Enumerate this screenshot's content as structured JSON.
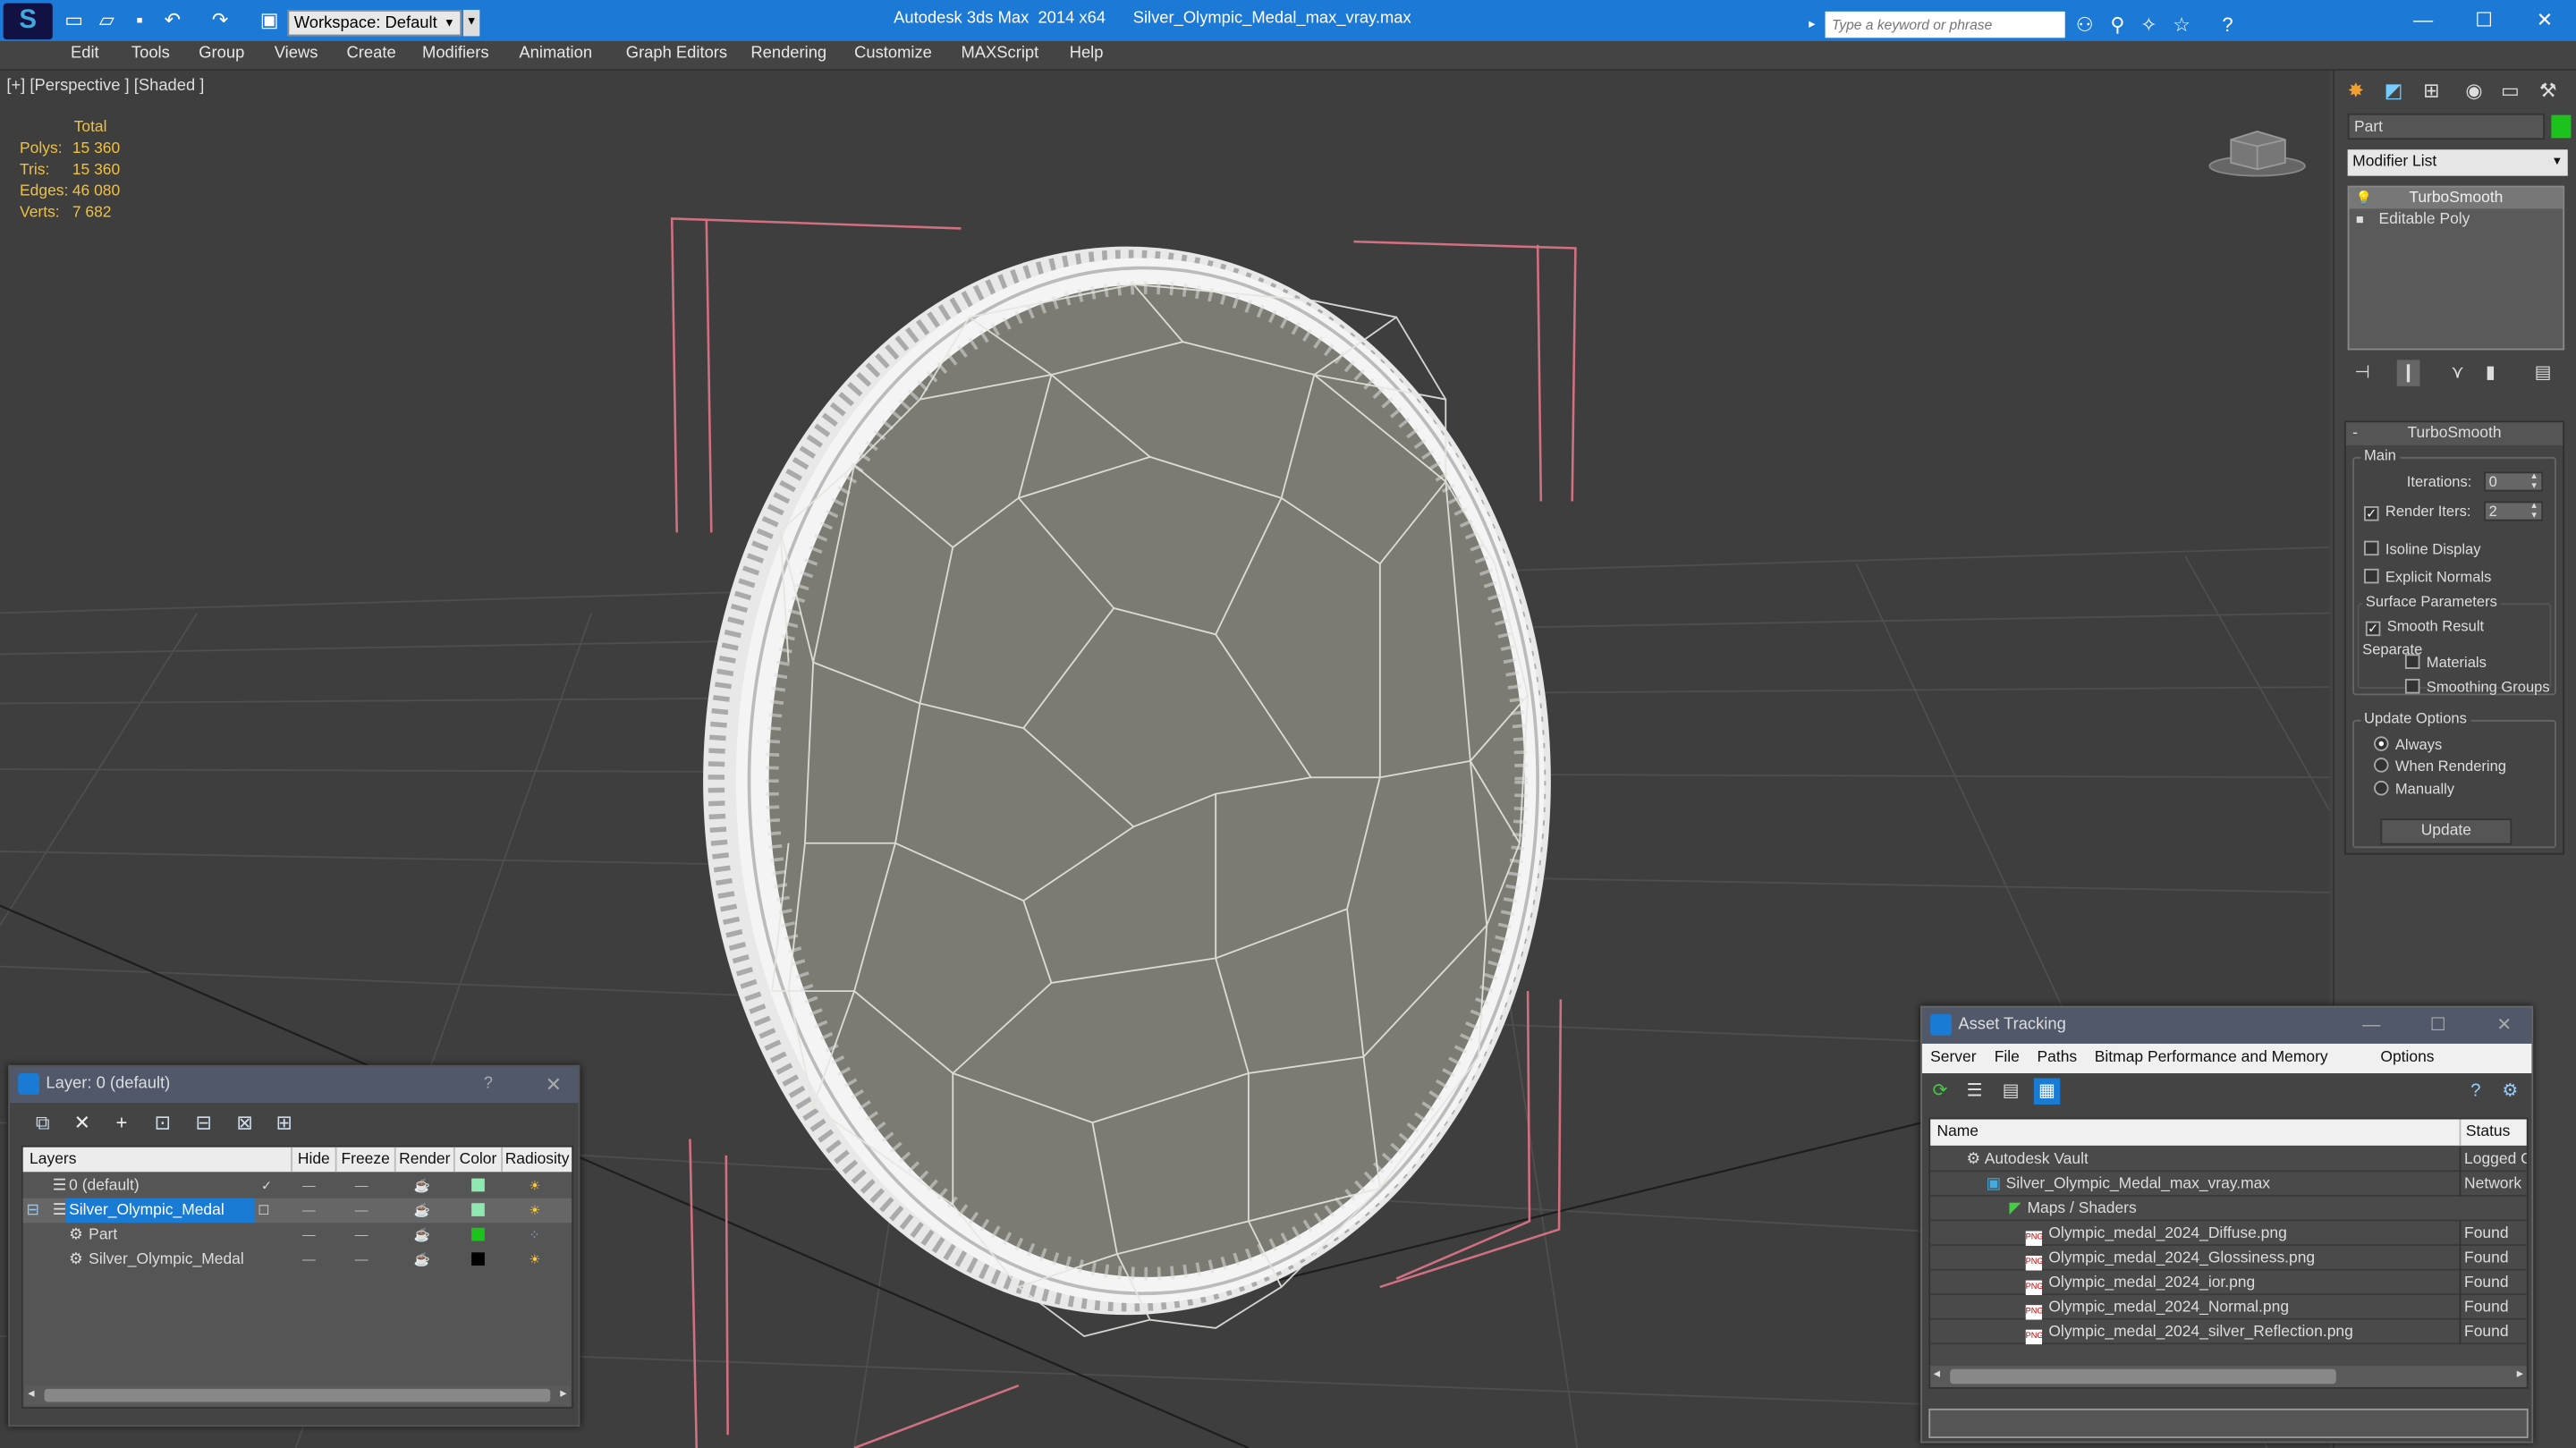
{
  "titlebar": {
    "workspace": "Workspace: Default",
    "app_title": "Autodesk 3ds Max  2014 x64",
    "file_name": "Silver_Olympic_Medal_max_vray.max",
    "search_placeholder": "Type a keyword or phrase"
  },
  "menu": [
    "Edit",
    "Tools",
    "Group",
    "Views",
    "Create",
    "Modifiers",
    "Animation",
    "Graph Editors",
    "Rendering",
    "Customize",
    "MAXScript",
    "Help"
  ],
  "viewport": {
    "label": "[+] [Perspective ] [Shaded ]",
    "stats": {
      "header": "Total",
      "polys_label": "Polys:",
      "polys": "15 360",
      "tris_label": "Tris:",
      "tris": "15 360",
      "edges_label": "Edges:",
      "edges": "46 080",
      "verts_label": "Verts:",
      "verts": "7 682"
    }
  },
  "command_panel": {
    "object_name": "Part",
    "object_color": "#1dc31d",
    "modifier_list": "Modifier List",
    "stack": [
      "TurboSmooth",
      "Editable Poly"
    ],
    "turbosmooth": {
      "title": "TurboSmooth",
      "main": "Main",
      "iterations_label": "Iterations:",
      "iterations": "0",
      "render_iters_label": "Render Iters:",
      "render_iters": "2",
      "isoline": "Isoline Display",
      "explicit_normals": "Explicit Normals",
      "surface_params": "Surface Parameters",
      "smooth_result": "Smooth Result",
      "separate": "Separate",
      "materials": "Materials",
      "smoothing_groups": "Smoothing Groups",
      "update_options": "Update Options",
      "always": "Always",
      "when_rendering": "When Rendering",
      "manually": "Manually",
      "update_button": "Update"
    }
  },
  "layer_window": {
    "title": "Layer: 0 (default)",
    "help": "?",
    "columns": [
      "Layers",
      "Hide",
      "Freeze",
      "Render",
      "Color",
      "Radiosity"
    ],
    "rows": [
      {
        "name": "0 (default)",
        "color": "#8ee8b0"
      },
      {
        "name": "Silver_Olympic_Medal",
        "color": "#8ee8b0"
      },
      {
        "name": "Part",
        "color": "#1dc31d"
      },
      {
        "name": "Silver_Olympic_Medal",
        "color": "#000000"
      }
    ]
  },
  "asset_window": {
    "title": "Asset Tracking",
    "menu": [
      "Server",
      "File",
      "Paths",
      "Bitmap Performance and Memory",
      "Options"
    ],
    "col_name": "Name",
    "col_status": "Status",
    "rows": [
      {
        "name": "Autodesk Vault",
        "status": "Logged O"
      },
      {
        "name": "Silver_Olympic_Medal_max_vray.max",
        "status": "Network I"
      },
      {
        "name": "Maps / Shaders",
        "status": ""
      },
      {
        "name": "Olympic_medal_2024_Diffuse.png",
        "status": "Found"
      },
      {
        "name": "Olympic_medal_2024_Glossiness.png",
        "status": "Found"
      },
      {
        "name": "Olympic_medal_2024_ior.png",
        "status": "Found"
      },
      {
        "name": "Olympic_medal_2024_Normal.png",
        "status": "Found"
      },
      {
        "name": "Olympic_medal_2024_silver_Reflection.png",
        "status": "Found"
      }
    ]
  }
}
